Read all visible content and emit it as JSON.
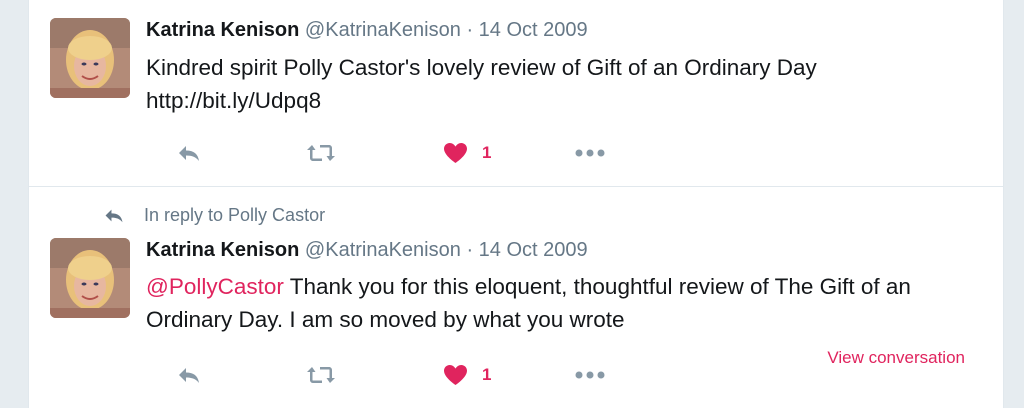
{
  "tweets": [
    {
      "author": {
        "fullname": "Katrina Kenison",
        "username": "@KatrinaKenison"
      },
      "separator": "·",
      "date": "14 Oct 2009",
      "text_parts": {
        "body": "Kindred spirit Polly Castor's  lovely review of Gift of an Ordinary Day",
        "link": "http://bit.ly/Udpq8"
      },
      "actions": {
        "reply_icon": "reply-icon",
        "retweet_icon": "retweet-icon",
        "like_icon": "heart-icon",
        "like_count": "1",
        "more_icon": "more-icon"
      }
    },
    {
      "in_reply_to": "In reply to Polly Castor",
      "author": {
        "fullname": "Katrina Kenison",
        "username": "@KatrinaKenison"
      },
      "separator": "·",
      "date": "14 Oct 2009",
      "text_parts": {
        "mention": "@PollyCastor",
        "body": " Thank you for this  eloquent, thoughtful  review of The Gift of an Ordinary Day.  I am so moved by what you wrote"
      },
      "actions": {
        "reply_icon": "reply-icon",
        "retweet_icon": "retweet-icon",
        "like_icon": "heart-icon",
        "like_count": "1",
        "more_icon": "more-icon"
      },
      "view_conversation": "View conversation"
    }
  ],
  "colors": {
    "accent": "#e0245e",
    "secondary_text": "#657786",
    "primary_text": "#14171a",
    "icon_gray": "#8899a6"
  }
}
